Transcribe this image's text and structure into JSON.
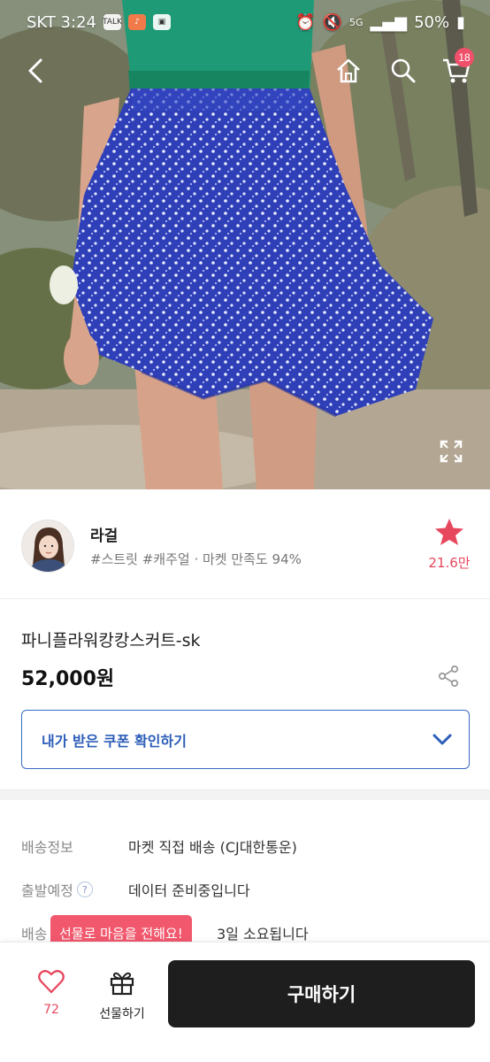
{
  "status_bar": {
    "carrier_time": "SKT 3:24",
    "talk_badge": "TALK",
    "network": "5G",
    "battery": "50%"
  },
  "nav": {
    "back_icon": "chevron-left-icon",
    "home_icon": "home-icon",
    "search_icon": "search-icon",
    "cart_icon": "cart-icon",
    "cart_count": "18"
  },
  "seller": {
    "name": "라걸",
    "tags": "#스트릿 #캐주얼 · 마켓 만족도 94%",
    "favorite_count": "21.6만",
    "favorite_color": "#e6475d"
  },
  "product": {
    "name": "파니플라워캉캉스커트-sk",
    "price": "52,000원",
    "coupon_label": "내가 받은 쿠폰 확인하기"
  },
  "shipping": {
    "rows": [
      {
        "key": "배송정보",
        "value": "마켓 직접 배송 (CJ대한통운)"
      },
      {
        "key": "출발예정",
        "help": "?",
        "value": "데이터 준비중입니다"
      },
      {
        "key": "배송",
        "value": "3일 소요됩니다"
      }
    ]
  },
  "tooltip": {
    "text": "선물로 마음을 전해요!"
  },
  "bottom_bar": {
    "like_count": "72",
    "gift_label": "선물하기",
    "buy_label": "구매하기"
  },
  "colors": {
    "accent_red": "#f2586d",
    "coupon_blue": "#2c5db8",
    "buy_button": "#1e1e1e"
  }
}
